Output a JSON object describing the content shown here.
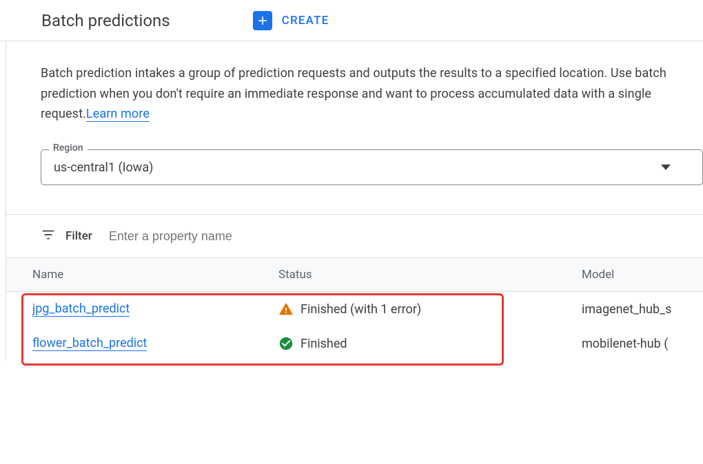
{
  "header": {
    "title": "Batch predictions",
    "create_label": "CREATE"
  },
  "description": {
    "text_part1": "Batch prediction intakes a group of prediction requests and outputs the results to a specified location. Use batch prediction when you don't require an immediate response and want to process accumulated data with a single request.",
    "learn_more": "Learn more"
  },
  "region": {
    "label": "Region",
    "value": "us-central1 (Iowa)"
  },
  "filter": {
    "label": "Filter",
    "placeholder": "Enter a property name"
  },
  "table": {
    "columns": {
      "name": "Name",
      "status": "Status",
      "model": "Model"
    },
    "rows": [
      {
        "name": "jpg_batch_predict",
        "status": "Finished (with 1 error)",
        "status_type": "warning",
        "model": "imagenet_hub_s"
      },
      {
        "name": "flower_batch_predict",
        "status": "Finished",
        "status_type": "success",
        "model": "mobilenet-hub ("
      }
    ]
  }
}
